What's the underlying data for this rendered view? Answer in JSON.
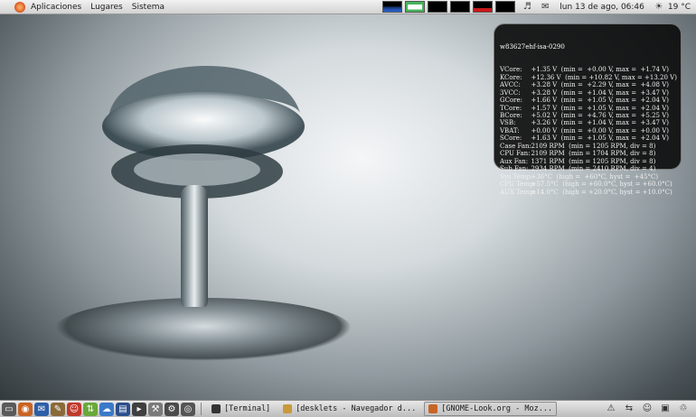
{
  "top_panel": {
    "menus": [
      "Aplicaciones",
      "Lugares",
      "Sistema"
    ],
    "clock": "lun 13 de ago, 06:46",
    "weather": "19 °C",
    "icons": {
      "distro": "ubuntu-icon",
      "volume": "volume-icon",
      "mail": "mail-icon",
      "weather": "weather-icon"
    }
  },
  "desklet": {
    "title": "w83627ehf-isa-0290",
    "rows": [
      {
        "label": "VCore:",
        "value": "+1.35 V  (min =  +0.00 V, max =  +1.74 V)"
      },
      {
        "label": "KCore:",
        "value": "+12.36 V  (min = +10.82 V, max = +13.20 V)"
      },
      {
        "label": "AVCC:",
        "value": "+3.28 V  (min =  +2.29 V, max =  +4.08 V)"
      },
      {
        "label": "3VCC:",
        "value": "+3.28 V  (min =  +1.04 V, max =  +3.47 V)"
      },
      {
        "label": "GCore:",
        "value": "+1.66 V  (min =  +1.05 V, max =  +2.04 V)"
      },
      {
        "label": "TCore:",
        "value": "+1.57 V  (min =  +1.05 V, max =  +2.04 V)"
      },
      {
        "label": "BCore:",
        "value": "+5.02 V  (min =  +4.76 V, max =  +5.25 V)"
      },
      {
        "label": "VSB:",
        "value": "+3.26 V  (min =  +1.04 V, max =  +3.47 V)"
      },
      {
        "label": "VBAT:",
        "value": "+0.00 V  (min =  +0.00 V, max =  +0.00 V)"
      },
      {
        "label": "SCore:",
        "value": "+1.63 V  (min =  +1.05 V, max =  +2.04 V)"
      },
      {
        "label": "Case Fan:",
        "value": "2109 RPM  (min = 1205 RPM, div = 8)"
      },
      {
        "label": "CPU Fan:",
        "value": "2109 RPM  (min = 1704 RPM, div = 8)"
      },
      {
        "label": "Aux Fan:",
        "value": "1371 RPM  (min = 1205 RPM, div = 8)"
      },
      {
        "label": "Sub Fan:",
        "value": "2934 RPM  (min = 2410 RPM, div = 4)"
      },
      {
        "label": "Sys Temp:",
        "value": "+36°C  (high =  +60°C, hyst =  +45°C)"
      },
      {
        "label": "CPU Temp:",
        "value": "+57.5°C  (high = +60.0°C, hyst = +60.0°C)"
      },
      {
        "label": "AUX Temp:",
        "value": "+14.0°C  (high = +20.0°C, hyst = +10.0°C)"
      }
    ]
  },
  "bottom_panel": {
    "launchers": [
      {
        "icon": "show-desktop-icon",
        "color": "#5a5a5a"
      },
      {
        "icon": "firefox-icon",
        "color": "#c86424"
      },
      {
        "icon": "thunderbird-icon",
        "color": "#2d5fa8"
      },
      {
        "icon": "gimp-icon",
        "color": "#8a6a3a"
      },
      {
        "icon": "pidgin-icon",
        "color": "#c0392b"
      },
      {
        "icon": "bittorrent-icon",
        "color": "#6aa83a"
      },
      {
        "icon": "network-icon",
        "color": "#3a7ac8"
      },
      {
        "icon": "office-icon",
        "color": "#2a4f8c"
      },
      {
        "icon": "terminal-icon",
        "color": "#3f3f3f"
      },
      {
        "icon": "tools-icon",
        "color": "#7a7a7a"
      },
      {
        "icon": "settings-icon",
        "color": "#4a4a4a"
      },
      {
        "icon": "camera-icon",
        "color": "#555555"
      }
    ],
    "tasks": [
      {
        "label": "[Terminal]",
        "icon": "terminal-icon",
        "color": "#333333",
        "active": false
      },
      {
        "label": "[desklets - Navegador d...",
        "icon": "folder-icon",
        "color": "#c89a3c",
        "active": false
      },
      {
        "label": "[GNOME-Look.org - Moz...",
        "icon": "firefox-icon",
        "color": "#c86424",
        "active": true
      }
    ],
    "tray": [
      "update-icon",
      "network-tray-icon",
      "chat-tray-icon",
      "display-icon",
      "trash-icon"
    ]
  }
}
